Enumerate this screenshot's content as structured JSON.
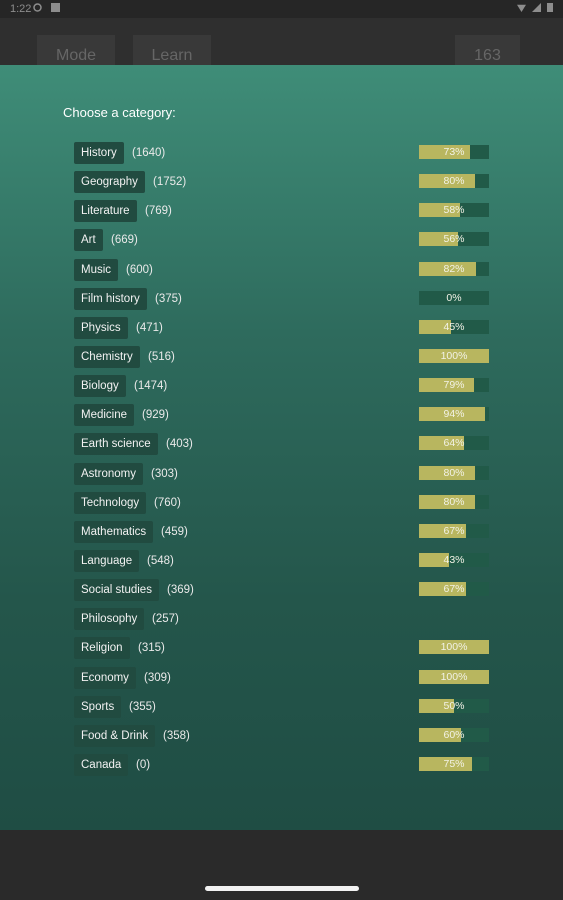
{
  "status": {
    "time": "1:22"
  },
  "appbar": {
    "mode_label": "Mode",
    "learn_label": "Learn",
    "count": "163"
  },
  "prompt": "Choose a category:",
  "categories": [
    {
      "name": "History",
      "count": "(1640)",
      "percent_label": "73%",
      "progress": 0.73
    },
    {
      "name": "Geography",
      "count": "(1752)",
      "percent_label": "80%",
      "progress": 0.8
    },
    {
      "name": "Literature",
      "count": "(769)",
      "percent_label": "58%",
      "progress": 0.58
    },
    {
      "name": "Art",
      "count": "(669)",
      "percent_label": "56%",
      "progress": 0.56
    },
    {
      "name": "Music",
      "count": "(600)",
      "percent_label": "82%",
      "progress": 0.82
    },
    {
      "name": "Film history",
      "count": "(375)",
      "percent_label": "0%",
      "progress": 0.0
    },
    {
      "name": "Physics",
      "count": "(471)",
      "percent_label": "45%",
      "progress": 0.45
    },
    {
      "name": "Chemistry",
      "count": "(516)",
      "percent_label": "100%",
      "progress": 1.0
    },
    {
      "name": "Biology",
      "count": "(1474)",
      "percent_label": "79%",
      "progress": 0.79
    },
    {
      "name": "Medicine",
      "count": "(929)",
      "percent_label": "94%",
      "progress": 0.94
    },
    {
      "name": "Earth science",
      "count": "(403)",
      "percent_label": "64%",
      "progress": 0.64
    },
    {
      "name": "Astronomy",
      "count": "(303)",
      "percent_label": "80%",
      "progress": 0.8
    },
    {
      "name": "Technology",
      "count": "(760)",
      "percent_label": "80%",
      "progress": 0.8
    },
    {
      "name": "Mathematics",
      "count": "(459)",
      "percent_label": "67%",
      "progress": 0.67
    },
    {
      "name": "Language",
      "count": "(548)",
      "percent_label": "43%",
      "progress": 0.43
    },
    {
      "name": "Social studies",
      "count": "(369)",
      "percent_label": "67%",
      "progress": 0.67
    },
    {
      "name": "Philosophy",
      "count": "(257)",
      "percent_label": "",
      "progress": null
    },
    {
      "name": "Religion",
      "count": "(315)",
      "percent_label": "100%",
      "progress": 1.0
    },
    {
      "name": "Economy",
      "count": "(309)",
      "percent_label": "100%",
      "progress": 1.0
    },
    {
      "name": "Sports",
      "count": "(355)",
      "percent_label": "50%",
      "progress": 0.5
    },
    {
      "name": "Food & Drink",
      "count": "(358)",
      "percent_label": "60%",
      "progress": 0.6
    },
    {
      "name": "Canada",
      "count": "(0)",
      "percent_label": "75%",
      "progress": 0.75
    }
  ],
  "colors": {
    "progress_fill": "#b8b65f",
    "progress_track": "#215a48",
    "chip": "#214b40",
    "overlay_top": "#3f8d78",
    "overlay_bottom": "#1f4d44"
  }
}
